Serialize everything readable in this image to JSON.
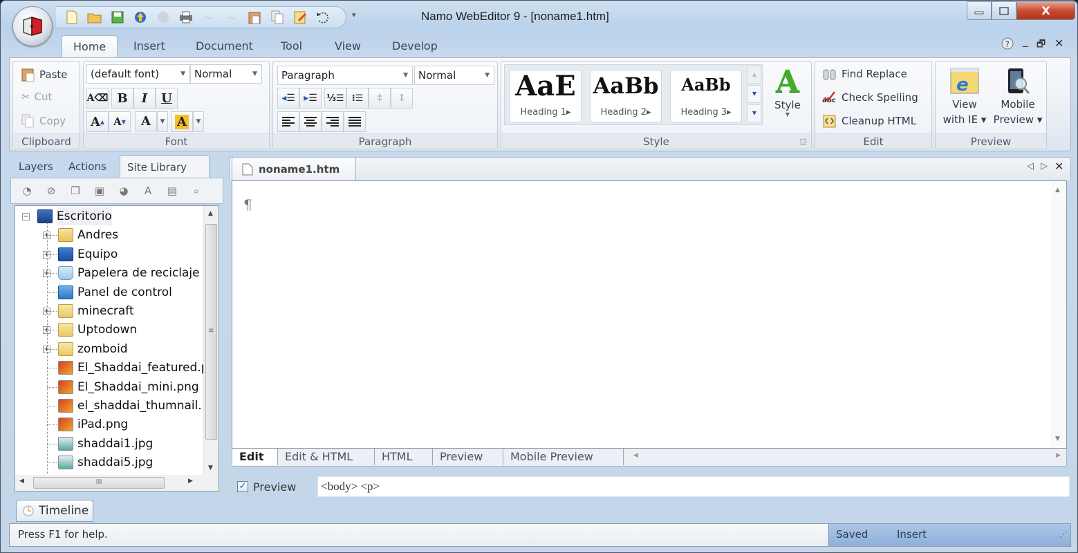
{
  "window": {
    "title": "Namo WebEditor 9 - [noname1.htm]",
    "controls": {
      "minimize": "minimize-icon",
      "maximize": "maximize-icon",
      "close": "close-icon"
    }
  },
  "quick_access": [
    {
      "name": "new-document-icon"
    },
    {
      "name": "open-folder-icon"
    },
    {
      "name": "save-icon"
    },
    {
      "name": "publish-icon"
    },
    {
      "name": "preview-disabled-icon"
    },
    {
      "name": "print-icon"
    },
    {
      "name": "undo-disabled-icon"
    },
    {
      "name": "redo-disabled-icon"
    },
    {
      "name": "paste-icon"
    },
    {
      "name": "copy-icon"
    },
    {
      "name": "edit-icon"
    },
    {
      "name": "refresh-icon"
    }
  ],
  "ribbon_tabs": [
    "Home",
    "Insert",
    "Document",
    "Tool",
    "View",
    "Develop"
  ],
  "ribbon_active_tab": "Home",
  "clipboard": {
    "label": "Clipboard",
    "paste": "Paste",
    "cut": "Cut",
    "copy": "Copy"
  },
  "font": {
    "label": "Font",
    "font_name": "(default font)",
    "font_size": "Normal",
    "bold": "B",
    "italic": "I",
    "underline": "U",
    "grow": "A",
    "shrink": "A",
    "color": "A",
    "highlight": "A",
    "highlight_color": "#f5c026",
    "underline_color": "#e2e6ea"
  },
  "paragraph": {
    "label": "Paragraph",
    "style_name": "Paragraph",
    "style_size": "Normal"
  },
  "style": {
    "label": "Style",
    "items": [
      {
        "sample": "AaE",
        "label": "Heading 1▸"
      },
      {
        "sample": "AaBb",
        "label": "Heading 2▸"
      },
      {
        "sample": "AaBb",
        "label": "Heading 3▸"
      }
    ],
    "big_button": "Style",
    "accent": "#3fae2a"
  },
  "edit": {
    "label": "Edit",
    "find_replace": "Find  Replace",
    "check_spelling": "Check Spelling",
    "cleanup_html": "Cleanup HTML"
  },
  "preview": {
    "label": "Preview",
    "view_ie_1": "View",
    "view_ie_2": "with IE ▾",
    "mobile_1": "Mobile",
    "mobile_2": "Preview ▾"
  },
  "left_panel": {
    "tabs": [
      "Layers",
      "Actions",
      "Site Library"
    ],
    "active_tab": "Site Library",
    "tree": [
      {
        "label": "Escritorio",
        "icon": "desktop-icon",
        "level": 0,
        "expander": "−"
      },
      {
        "label": "Andres",
        "icon": "user-folder-icon",
        "level": 1,
        "expander": "+"
      },
      {
        "label": "Equipo",
        "icon": "computer-icon",
        "level": 1,
        "expander": "+"
      },
      {
        "label": "Papelera de reciclaje",
        "icon": "recycle-bin-icon",
        "level": 1,
        "expander": "+"
      },
      {
        "label": "Panel de control",
        "icon": "control-panel-icon",
        "level": 1,
        "expander": ""
      },
      {
        "label": "minecraft",
        "icon": "folder-icon",
        "level": 1,
        "expander": "+"
      },
      {
        "label": "Uptodown",
        "icon": "folder-icon",
        "level": 1,
        "expander": "+"
      },
      {
        "label": "zomboid",
        "icon": "folder-icon",
        "level": 1,
        "expander": "+"
      },
      {
        "label": "El_Shaddai_featured.p",
        "icon": "png-file-icon",
        "level": 1,
        "expander": ""
      },
      {
        "label": "El_Shaddai_mini.png",
        "icon": "png-file-icon",
        "level": 1,
        "expander": ""
      },
      {
        "label": "el_shaddai_thumnail.",
        "icon": "png-file-icon",
        "level": 1,
        "expander": ""
      },
      {
        "label": "iPad.png",
        "icon": "png-file-icon",
        "level": 1,
        "expander": ""
      },
      {
        "label": "shaddai1.jpg",
        "icon": "jpg-file-icon",
        "level": 1,
        "expander": ""
      },
      {
        "label": "shaddai5.jpg",
        "icon": "jpg-file-icon",
        "level": 1,
        "expander": ""
      }
    ]
  },
  "document": {
    "tab": "noname1.htm",
    "pilcrow": "¶",
    "view_tabs": [
      "Edit",
      "Edit & HTML",
      "HTML",
      "Preview",
      "Mobile Preview"
    ],
    "active_view": "Edit"
  },
  "pathbar": {
    "preview_label": "Preview",
    "preview_checked": true,
    "path": "<body> <p>"
  },
  "timeline": {
    "label": "Timeline"
  },
  "status": {
    "help": "Press F1 for help.",
    "saved": "Saved",
    "mode": "Insert"
  }
}
